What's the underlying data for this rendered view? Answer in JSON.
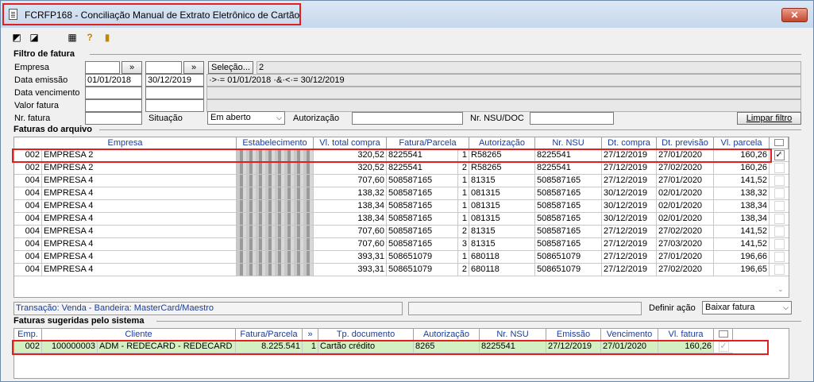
{
  "window": {
    "title": "FCRFP168 - Conciliação Manual de Extrato Eletrônico de Cartão",
    "close": "✕"
  },
  "filter": {
    "title": "Filtro de fatura",
    "empresa_label": "Empresa",
    "empresa_from": "",
    "empresa_to": "",
    "browse": "»",
    "selecao_label": "Seleção...",
    "selecao_value": "2",
    "data_emissao_label": "Data emissão",
    "data_emissao_from": "01/01/2018",
    "data_emissao_to": "30/12/2019",
    "data_emissao_summary": "·>·= 01/01/2018 ·&·<·= 30/12/2019",
    "data_vencimento_label": "Data vencimento",
    "valor_fatura_label": "Valor fatura",
    "nr_fatura_label": "Nr. fatura",
    "situacao_label": "Situação",
    "situacao_value": "Em aberto",
    "autorizacao_label": "Autorização",
    "nsu_label": "Nr. NSU/DOC",
    "clear_label": "Limpar filtro"
  },
  "faturas": {
    "title": "Faturas do arquivo",
    "columns": [
      "Empresa",
      "Estabelecimento",
      "Vl. total compra",
      "Fatura/Parcela",
      "Autorização",
      "Nr. NSU",
      "Dt. compra",
      "Dt. previsão",
      "Vl. parcela"
    ],
    "rows": [
      {
        "emp": "002",
        "empresa": "EMPRESA 2",
        "estab": "xxxxxxx",
        "total": "320,52",
        "fatura": "8225541",
        "parc": "1",
        "aut": "R58265",
        "nsu": "8225541",
        "compra": "27/12/2019",
        "prev": "27/01/2020",
        "vl": "160,26",
        "checked": "✓"
      },
      {
        "emp": "002",
        "empresa": "EMPRESA 2",
        "estab": "xxxxxxx",
        "total": "320,52",
        "fatura": "8225541",
        "parc": "2",
        "aut": "R58265",
        "nsu": "8225541",
        "compra": "27/12/2019",
        "prev": "27/02/2020",
        "vl": "160,26",
        "checked": ""
      },
      {
        "emp": "004",
        "empresa": "EMPRESA 4",
        "estab": "xxxxxxx",
        "total": "707,60",
        "fatura": "508587165",
        "parc": "1",
        "aut": "81315",
        "nsu": "508587165",
        "compra": "27/12/2019",
        "prev": "27/01/2020",
        "vl": "141,52",
        "checked": ""
      },
      {
        "emp": "004",
        "empresa": "EMPRESA 4",
        "estab": "xxxxxxx",
        "total": "138,32",
        "fatura": "508587165",
        "parc": "1",
        "aut": "081315",
        "nsu": "508587165",
        "compra": "30/12/2019",
        "prev": "02/01/2020",
        "vl": "138,32",
        "checked": ""
      },
      {
        "emp": "004",
        "empresa": "EMPRESA 4",
        "estab": "xxxxxxx",
        "total": "138,34",
        "fatura": "508587165",
        "parc": "1",
        "aut": "081315",
        "nsu": "508587165",
        "compra": "30/12/2019",
        "prev": "02/01/2020",
        "vl": "138,34",
        "checked": ""
      },
      {
        "emp": "004",
        "empresa": "EMPRESA 4",
        "estab": "xxxxxxx",
        "total": "138,34",
        "fatura": "508587165",
        "parc": "1",
        "aut": "081315",
        "nsu": "508587165",
        "compra": "30/12/2019",
        "prev": "02/01/2020",
        "vl": "138,34",
        "checked": ""
      },
      {
        "emp": "004",
        "empresa": "EMPRESA 4",
        "estab": "xxxxxxx",
        "total": "707,60",
        "fatura": "508587165",
        "parc": "2",
        "aut": "81315",
        "nsu": "508587165",
        "compra": "27/12/2019",
        "prev": "27/02/2020",
        "vl": "141,52",
        "checked": ""
      },
      {
        "emp": "004",
        "empresa": "EMPRESA 4",
        "estab": "xxxxxxx",
        "total": "707,60",
        "fatura": "508587165",
        "parc": "3",
        "aut": "81315",
        "nsu": "508587165",
        "compra": "27/12/2019",
        "prev": "27/03/2020",
        "vl": "141,52",
        "checked": ""
      },
      {
        "emp": "004",
        "empresa": "EMPRESA 4",
        "estab": "xxxxxxx",
        "total": "393,31",
        "fatura": "508651079",
        "parc": "1",
        "aut": "680118",
        "nsu": "508651079",
        "compra": "27/12/2019",
        "prev": "27/01/2020",
        "vl": "196,66",
        "checked": ""
      },
      {
        "emp": "004",
        "empresa": "EMPRESA 4",
        "estab": "xxxxxxx",
        "total": "393,31",
        "fatura": "508651079",
        "parc": "2",
        "aut": "680118",
        "nsu": "508651079",
        "compra": "27/12/2019",
        "prev": "27/02/2020",
        "vl": "196,65",
        "checked": ""
      }
    ]
  },
  "status": {
    "transacao": "Transação: Venda - Bandeira: MasterCard/Maestro",
    "definir_label": "Definir ação",
    "acao_value": "Baixar fatura"
  },
  "sugeridas": {
    "title": "Faturas sugeridas pelo sistema",
    "columns": [
      "Emp.",
      "Cliente",
      "Fatura/Parcela",
      "»",
      "Tp. documento",
      "Autorização",
      "Nr. NSU",
      "Emissão",
      "Vencimento",
      "Vl. fatura"
    ],
    "rows": [
      {
        "emp": "002",
        "cod": "100000003",
        "cliente": "ADM - REDECARD - REDECARD S/A",
        "fatura": "8.225.541",
        "parc": "1",
        "tipo": "Cartão crédito",
        "aut": "8265",
        "nsu": "8225541",
        "emissao": "27/12/2019",
        "venc": "27/01/2020",
        "vl": "160,26",
        "checked": "✓"
      }
    ]
  }
}
